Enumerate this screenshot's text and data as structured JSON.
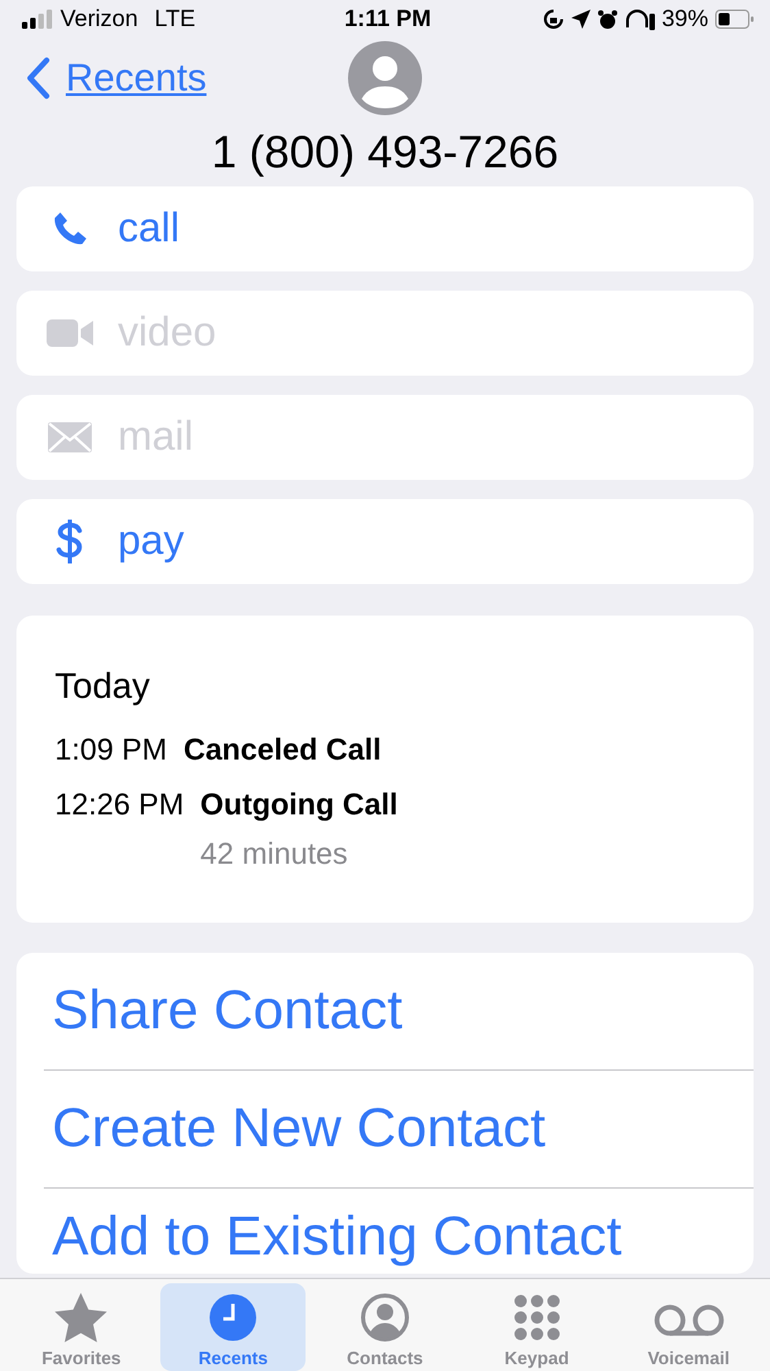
{
  "status_bar": {
    "carrier": "Verizon",
    "network": "LTE",
    "time": "1:11 PM",
    "battery": "39%"
  },
  "nav": {
    "back": "Recents"
  },
  "title": "1 (800) 493-7266",
  "actions": [
    {
      "kind": "call",
      "label": "call",
      "disabled": false
    },
    {
      "kind": "video",
      "label": "video",
      "disabled": true
    },
    {
      "kind": "mail",
      "label": "mail",
      "disabled": true
    },
    {
      "kind": "pay",
      "label": "pay",
      "disabled": false
    }
  ],
  "history": {
    "heading": "Today",
    "calls": [
      {
        "time": "1:09 PM",
        "type": "Canceled Call"
      },
      {
        "time": "12:26 PM",
        "type": "Outgoing Call",
        "duration": "42 minutes"
      }
    ]
  },
  "links": [
    "Share Contact",
    "Create New Contact",
    "Add to Existing Contact"
  ],
  "tabs": [
    {
      "kind": "favorites",
      "label": "Favorites",
      "selected": false
    },
    {
      "kind": "recents",
      "label": "Recents",
      "selected": true
    },
    {
      "kind": "contacts",
      "label": "Contacts",
      "selected": false
    },
    {
      "kind": "keypad",
      "label": "Keypad",
      "selected": false
    },
    {
      "kind": "voicemail",
      "label": "Voicemail",
      "selected": false
    }
  ]
}
